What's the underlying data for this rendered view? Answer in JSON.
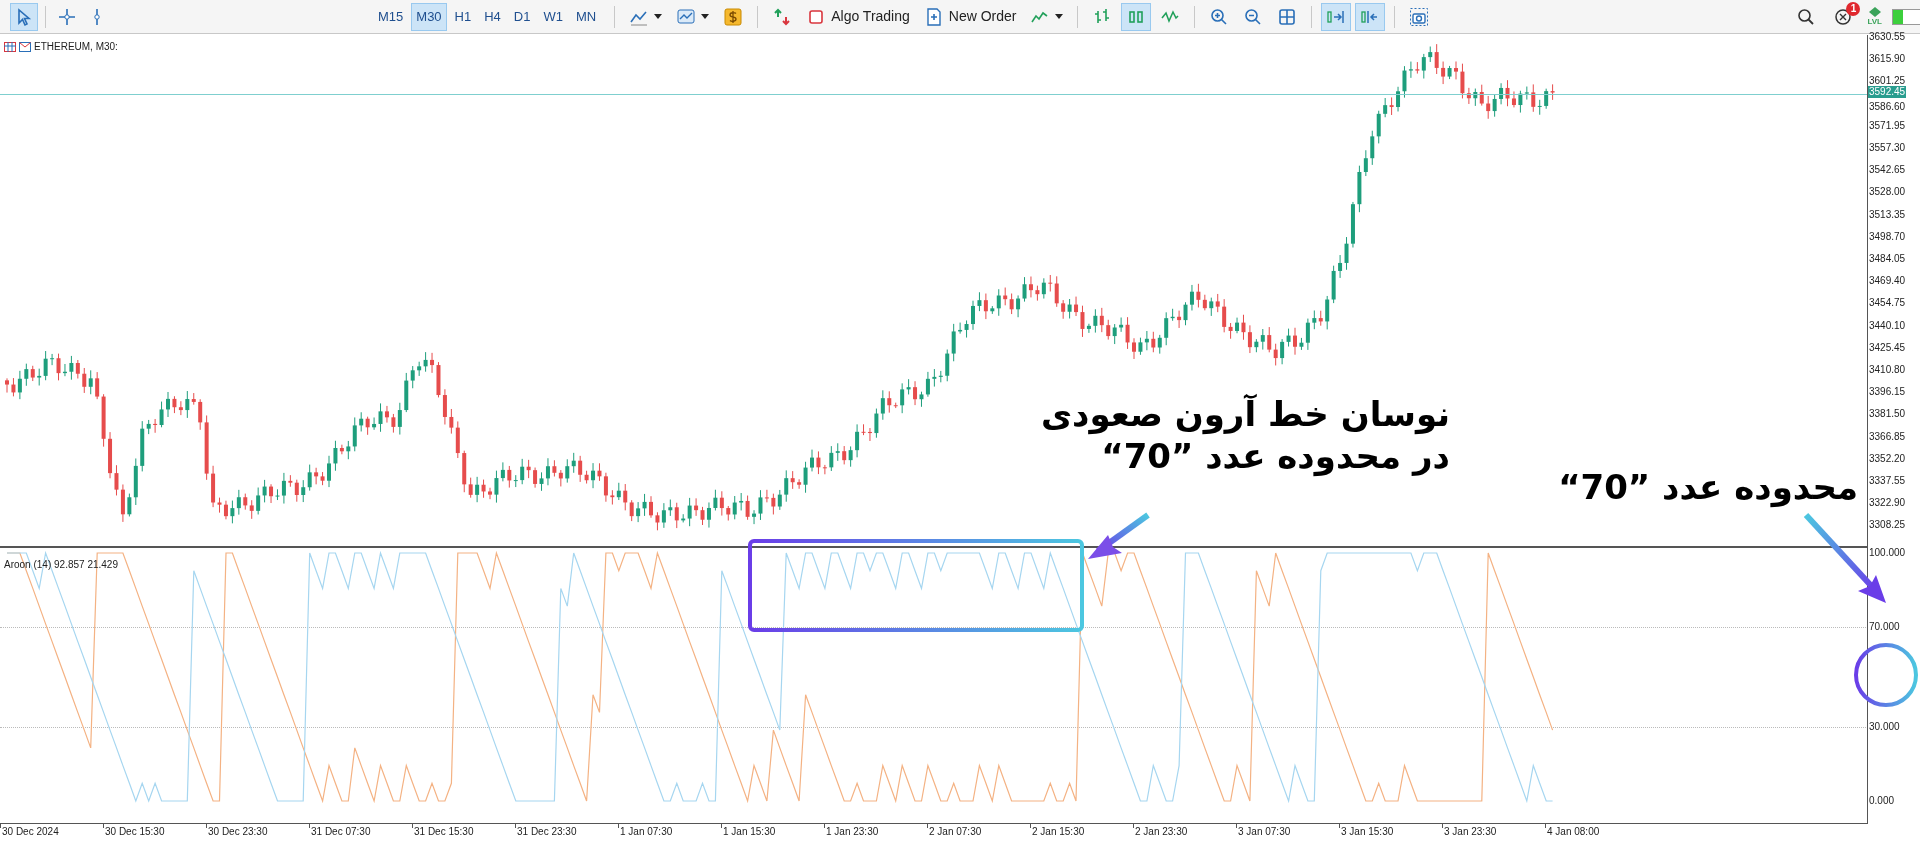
{
  "toolbar": {
    "tools": [
      {
        "kind": "cursor",
        "selected": true
      },
      {
        "kind": "crosshair",
        "selected": false
      },
      {
        "kind": "vline",
        "selected": false
      }
    ],
    "timeframes": [
      {
        "label": "M15",
        "selected": false
      },
      {
        "label": "M30",
        "selected": true
      },
      {
        "label": "H1",
        "selected": false
      },
      {
        "label": "H4",
        "selected": false
      },
      {
        "label": "D1",
        "selected": false
      },
      {
        "label": "W1",
        "selected": false
      },
      {
        "label": "MN",
        "selected": false
      }
    ],
    "buttons": [
      {
        "kind": "indicators",
        "caret": true,
        "selected": false
      },
      {
        "kind": "templates",
        "caret": true,
        "selected": false
      },
      {
        "kind": "dollar",
        "selected": false
      },
      {
        "kind": "separator"
      },
      {
        "kind": "trade",
        "selected": false
      },
      {
        "kind": "algo",
        "label": "Algo Trading",
        "selected": false
      },
      {
        "kind": "order",
        "label": "New Order",
        "selected": false
      },
      {
        "kind": "linechart",
        "caret": true,
        "selected": false
      },
      {
        "kind": "separator"
      },
      {
        "kind": "bars",
        "selected": false
      },
      {
        "kind": "candles",
        "selected": true
      },
      {
        "kind": "line",
        "selected": false
      },
      {
        "kind": "separator"
      },
      {
        "kind": "zoomin",
        "selected": false
      },
      {
        "kind": "zoomout",
        "selected": false
      },
      {
        "kind": "grid",
        "selected": false
      },
      {
        "kind": "separator"
      },
      {
        "kind": "autoscroll",
        "selected": true
      },
      {
        "kind": "shift",
        "selected": true
      },
      {
        "kind": "separator"
      },
      {
        "kind": "screenshot",
        "selected": false
      }
    ],
    "notifications": "1",
    "level_label": "LVL"
  },
  "chart": {
    "symbol": "ETHEREUM, M30:",
    "price_ticks": [
      "3630.55",
      "3615.90",
      "3601.25",
      "3586.60",
      "3571.95",
      "3557.30",
      "3542.65",
      "3528.00",
      "3513.35",
      "3498.70",
      "3484.05",
      "3469.40",
      "3454.75",
      "3440.10",
      "3425.45",
      "3410.80",
      "3396.15",
      "3381.50",
      "3366.85",
      "3352.20",
      "3337.55",
      "3322.90",
      "3308.25"
    ],
    "current_price": "3592.45"
  },
  "indicator": {
    "label": "Aroon (14) 92.857 21.429",
    "ticks": [
      "100.000",
      "70.000",
      "30.000",
      "0.000"
    ]
  },
  "time_axis": [
    "30 Dec 2024",
    "30 Dec 15:30",
    "30 Dec 23:30",
    "31 Dec 07:30",
    "31 Dec 15:30",
    "31 Dec 23:30",
    "1 Jan 07:30",
    "1 Jan 15:30",
    "1 Jan 23:30",
    "2 Jan 07:30",
    "2 Jan 15:30",
    "2 Jan 23:30",
    "3 Jan 07:30",
    "3 Jan 15:30",
    "3 Jan 23:30",
    "4 Jan 08:00"
  ],
  "annotations": {
    "caption_1": [
      "نوسان خط آرون صعودی",
      "در محدوده عدد ”70“"
    ],
    "caption_2": "محدوده عدد ”70“"
  }
}
